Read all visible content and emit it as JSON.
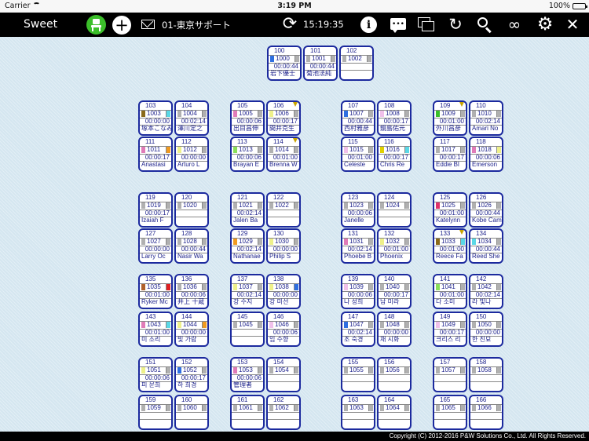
{
  "status_bar": {
    "carrier": "Carrier",
    "time": "3:19 PM",
    "battery": "100%"
  },
  "toolbar": {
    "app_title": "Sweet",
    "store_name": "01-東京サポート",
    "clock": "15:19:35",
    "add_label": "+",
    "info_label": "i",
    "chat_label": "•••"
  },
  "footer": {
    "copyright": "Copyright (C) 2012-2016 P&W Solutions Co., Ltd. All Rights Reserved."
  },
  "colors": {
    "accent_green": "#3bbf2a",
    "seat_border": "#1c2a9e",
    "toolbar_bg": "#000000",
    "floor_bg": "#d4e6f0"
  },
  "icons": [
    "wifi-icon",
    "battery-icon",
    "seat-icon",
    "add-icon",
    "mail-icon",
    "refresh-icon",
    "info-icon",
    "chat-icon",
    "windows-icon",
    "redo-icon",
    "search-icon",
    "link-icon",
    "gear-icon",
    "close-icon",
    "alert-flag-icon"
  ],
  "seats": [
    {
      "no": "100",
      "code": "1000",
      "time": "00:00:44",
      "name": "岩下優士",
      "color": "#2f6fe0",
      "color2": "#b0b0b0"
    },
    {
      "no": "101",
      "code": "1001",
      "time": "00:00:44",
      "name": "菊池法純",
      "color": "#b0b0b0",
      "color2": "#b0b0b0"
    },
    {
      "no": "102",
      "code": "1002",
      "time": "",
      "name": "",
      "color": "#b0b0b0",
      "color2": "#b0b0b0"
    },
    {
      "no": "103",
      "code": "1003",
      "time": "00:00:00",
      "name": "塚本こなみ",
      "color": "#8a6a1a",
      "color2": "#5ad8e6"
    },
    {
      "no": "104",
      "code": "1004",
      "time": "00:02:14",
      "name": "澤川定之",
      "color": "#b0b0b0",
      "color2": "#b0b0b0"
    },
    {
      "no": "105",
      "code": "1005",
      "time": "00:00:06",
      "name": "出目昌伸",
      "color": "#e07bb8",
      "color2": "#b0b0b0"
    },
    {
      "no": "106",
      "code": "1006",
      "time": "00:00:17",
      "name": "間井克生",
      "color": "#eef08a",
      "color2": "#b0b0b0",
      "flag": true
    },
    {
      "no": "107",
      "code": "1007",
      "time": "00:00:44",
      "name": "西村雅彦",
      "color": "#2f6fe0",
      "color2": "#b0b0b0"
    },
    {
      "no": "108",
      "code": "1008",
      "time": "00:00:17",
      "name": "鏡島佑元",
      "color": "#f0c0ea",
      "color2": "#b0b0b0"
    },
    {
      "no": "109",
      "code": "1009",
      "time": "00:01:00",
      "name": "外川昌彦",
      "color": "#3bbf2a",
      "color2": "#b0b0b0",
      "flag": true
    },
    {
      "no": "110",
      "code": "1010",
      "time": "00:02:14",
      "name": "Amari No",
      "color": "#b0b0b0",
      "color2": "#b0b0b0"
    },
    {
      "no": "111",
      "code": "1011",
      "time": "00:00:17",
      "name": "Anastasi",
      "color": "#e07bb8",
      "color2": "#f09a20"
    },
    {
      "no": "112",
      "code": "1012",
      "time": "00:00:00",
      "name": "Arturo L",
      "color": "#eef08a",
      "color2": "#b0b0b0"
    },
    {
      "no": "113",
      "code": "1013",
      "time": "00:00:06",
      "name": "Brayan E",
      "color": "#8adf5a",
      "color2": "#b0b0b0"
    },
    {
      "no": "114",
      "code": "1014",
      "time": "00:01:00",
      "name": "Brenna W",
      "color": "#b0b0b0",
      "color2": "#b0b0b0",
      "flag": true
    },
    {
      "no": "115",
      "code": "1015",
      "time": "00:01:00",
      "name": "Celeste",
      "color": "#f0c0ea",
      "color2": "#b0b0b0"
    },
    {
      "no": "116",
      "code": "1016",
      "time": "00:00:17",
      "name": "Chris Re",
      "color": "#e0d000",
      "color2": "#5ad8e6"
    },
    {
      "no": "117",
      "code": "1017",
      "time": "00:00:17",
      "name": "Eddie Bl",
      "color": "#b0b0b0",
      "color2": "#b0b0b0"
    },
    {
      "no": "118",
      "code": "1018",
      "time": "00:00:06",
      "name": "Emerson",
      "color": "#e07bb8",
      "color2": "#eef08a"
    },
    {
      "no": "119",
      "code": "1019",
      "time": "00:00:17",
      "name": "Izaiah F",
      "color": "#b0b0b0",
      "color2": "#b0b0b0"
    },
    {
      "no": "120",
      "code": "1020",
      "time": "",
      "name": "",
      "color": "#b0b0b0",
      "color2": "#b0b0b0"
    },
    {
      "no": "121",
      "code": "1021",
      "time": "00:02:14",
      "name": "Jalen Ba",
      "color": "#b0b0b0",
      "color2": "#b0b0b0"
    },
    {
      "no": "122",
      "code": "1022",
      "time": "",
      "name": "",
      "color": "#b0b0b0",
      "color2": "#b0b0b0"
    },
    {
      "no": "123",
      "code": "1023",
      "time": "00:00:06",
      "name": "Janelle",
      "color": "#b0b0b0",
      "color2": "#b0b0b0"
    },
    {
      "no": "124",
      "code": "1024",
      "time": "",
      "name": "",
      "color": "#b0b0b0",
      "color2": "#b0b0b0"
    },
    {
      "no": "125",
      "code": "1025",
      "time": "00:01:00",
      "name": "Katelynn",
      "color": "#e0336a",
      "color2": "#b0b0b0"
    },
    {
      "no": "126",
      "code": "1026",
      "time": "00:00:44",
      "name": "Kobe Cam",
      "color": "#b0b0b0",
      "color2": "#b0b0b0"
    },
    {
      "no": "127",
      "code": "1027",
      "time": "00:00:00",
      "name": "Larry Oc",
      "color": "#b0b0b0",
      "color2": "#b0b0b0"
    },
    {
      "no": "128",
      "code": "1028",
      "time": "00:00:44",
      "name": "Nasir Wa",
      "color": "#b0b0b0",
      "color2": "#b0b0b0"
    },
    {
      "no": "129",
      "code": "1029",
      "time": "00:02:14",
      "name": "Nathanae",
      "color": "#f09a20",
      "color2": "#b0b0b0"
    },
    {
      "no": "130",
      "code": "1030",
      "time": "00:00:00",
      "name": "Philip S",
      "color": "#eef08a",
      "color2": "#b0b0b0"
    },
    {
      "no": "131",
      "code": "1031",
      "time": "00:02:14",
      "name": "Phoebe B",
      "color": "#e07bb8",
      "color2": "#b0b0b0"
    },
    {
      "no": "132",
      "code": "1032",
      "time": "00:01:00",
      "name": "Phoenix",
      "color": "#eef08a",
      "color2": "#b0b0b0"
    },
    {
      "no": "133",
      "code": "1033",
      "time": "00:01:00",
      "name": "Reece Fa",
      "color": "#8a6a1a",
      "color2": "#5ad8e6",
      "flag": true
    },
    {
      "no": "134",
      "code": "1034",
      "time": "00:00:44",
      "name": "Reed She",
      "color": "#5ad8e6",
      "color2": "#b0b0b0"
    },
    {
      "no": "135",
      "code": "1035",
      "time": "00:01:00",
      "name": "Ryker Mc",
      "color": "#b0602a",
      "color2": "#e02020"
    },
    {
      "no": "136",
      "code": "1036",
      "time": "00:00:06",
      "name": "井上 十蔵",
      "color": "#b0b0b0",
      "color2": "#b0b0b0"
    },
    {
      "no": "137",
      "code": "1037",
      "time": "00:02:14",
      "name": "강 수지",
      "color": "#eef08a",
      "color2": "#b0b0b0"
    },
    {
      "no": "138",
      "code": "1038",
      "time": "00:00:00",
      "name": "강 미선",
      "color": "#eef08a",
      "color2": "#2f6fe0"
    },
    {
      "no": "139",
      "code": "1039",
      "time": "00:00:06",
      "name": "나 성희",
      "color": "#f0c0ea",
      "color2": "#b0b0b0"
    },
    {
      "no": "140",
      "code": "1040",
      "time": "00:00:17",
      "name": "남 미라",
      "color": "#b0b0b0",
      "color2": "#b0b0b0"
    },
    {
      "no": "141",
      "code": "1041",
      "time": "00:01:00",
      "name": "다 소미",
      "color": "#8adf5a",
      "color2": "#b0b0b0"
    },
    {
      "no": "142",
      "code": "1042",
      "time": "00:02:14",
      "name": "라 빛나",
      "color": "#b0b0b0",
      "color2": "#b0b0b0"
    },
    {
      "no": "143",
      "code": "1043",
      "time": "00:01:00",
      "name": "미 소리",
      "color": "#e07bb8",
      "color2": "#5ad8e6"
    },
    {
      "no": "144",
      "code": "1044",
      "time": "00:00:00",
      "name": "빛 가람",
      "color": "#eef08a",
      "color2": "#f09a20"
    },
    {
      "no": "145",
      "code": "1045",
      "time": "",
      "name": "",
      "color": "#b0b0b0",
      "color2": "#b0b0b0"
    },
    {
      "no": "146",
      "code": "1046",
      "time": "00:00:06",
      "name": "임 수향",
      "color": "#f0c0ea",
      "color2": "#b0b0b0"
    },
    {
      "no": "147",
      "code": "1047",
      "time": "00:02:14",
      "name": "조 숙경",
      "color": "#2f6fe0",
      "color2": "#b0b0b0"
    },
    {
      "no": "148",
      "code": "1048",
      "time": "00:00:00",
      "name": "채 시화",
      "color": "#b0b0b0",
      "color2": "#b0b0b0"
    },
    {
      "no": "149",
      "code": "1049",
      "time": "00:00:17",
      "name": "크리스 리",
      "color": "#f0c0ea",
      "color2": "#b0b0b0"
    },
    {
      "no": "150",
      "code": "1050",
      "time": "00:00:00",
      "name": "한 진묘",
      "color": "#b0b0b0",
      "color2": "#b0b0b0"
    },
    {
      "no": "151",
      "code": "1051",
      "time": "00:00:06",
      "name": "피 문희",
      "color": "#eef08a",
      "color2": "#b0b0b0"
    },
    {
      "no": "152",
      "code": "1052",
      "time": "00:00:17",
      "name": "하 희경",
      "color": "#2f6fe0",
      "color2": "#b0b0b0"
    },
    {
      "no": "153",
      "code": "1053",
      "time": "00:00:06",
      "name": "管理者",
      "color": "#e07bb8",
      "color2": "#b0b0b0"
    },
    {
      "no": "154",
      "code": "1054",
      "time": "",
      "name": "",
      "color": "#b0b0b0",
      "color2": "#b0b0b0"
    },
    {
      "no": "155",
      "code": "1055",
      "time": "",
      "name": "",
      "color": "#b0b0b0",
      "color2": "#b0b0b0"
    },
    {
      "no": "156",
      "code": "1056",
      "time": "",
      "name": "",
      "color": "#b0b0b0",
      "color2": "#b0b0b0"
    },
    {
      "no": "157",
      "code": "1057",
      "time": "",
      "name": "",
      "color": "#b0b0b0",
      "color2": "#b0b0b0"
    },
    {
      "no": "158",
      "code": "1058",
      "time": "",
      "name": "",
      "color": "#b0b0b0",
      "color2": "#b0b0b0"
    },
    {
      "no": "159",
      "code": "1059",
      "time": "",
      "name": "",
      "color": "#b0b0b0",
      "color2": "#b0b0b0"
    },
    {
      "no": "160",
      "code": "1060",
      "time": "",
      "name": "",
      "color": "#b0b0b0",
      "color2": "#b0b0b0"
    },
    {
      "no": "161",
      "code": "1061",
      "time": "",
      "name": "",
      "color": "#b0b0b0",
      "color2": "#b0b0b0"
    },
    {
      "no": "162",
      "code": "1062",
      "time": "",
      "name": "",
      "color": "#b0b0b0",
      "color2": "#b0b0b0"
    },
    {
      "no": "163",
      "code": "1063",
      "time": "",
      "name": "",
      "color": "#b0b0b0",
      "color2": "#b0b0b0"
    },
    {
      "no": "164",
      "code": "1064",
      "time": "",
      "name": "",
      "color": "#b0b0b0",
      "color2": "#b0b0b0"
    },
    {
      "no": "165",
      "code": "1065",
      "time": "",
      "name": "",
      "color": "#b0b0b0",
      "color2": "#b0b0b0"
    },
    {
      "no": "166",
      "code": "1066",
      "time": "",
      "name": "",
      "color": "#b0b0b0",
      "color2": "#b0b0b0"
    }
  ]
}
